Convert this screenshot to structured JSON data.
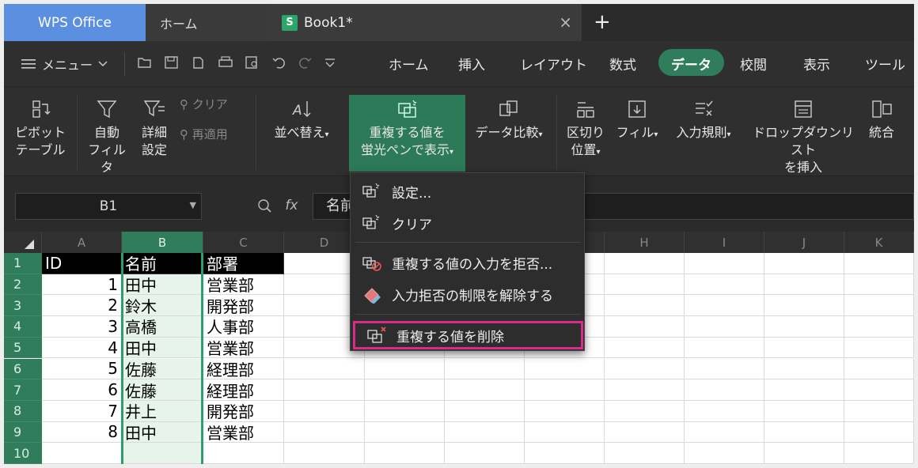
{
  "titlebar": {
    "app_tab": "WPS Office",
    "home_tab": "ホーム",
    "doc_tab": "Book1*",
    "doc_icon_letter": "S",
    "close_glyph": "×",
    "plus_glyph": "+"
  },
  "menubar": {
    "menu_label": "メニュー",
    "tabs": [
      "ホーム",
      "挿入",
      "レイアウト",
      "数式",
      "データ",
      "校閲",
      "表示",
      "ツール"
    ],
    "active_tab": "データ"
  },
  "ribbon": {
    "pivot": [
      "ピボット",
      "テーブル"
    ],
    "autofilter": [
      "自動",
      "フィルタ"
    ],
    "advanced": [
      "詳細",
      "設定"
    ],
    "clear": "クリア",
    "reapply": "再適用",
    "sort": "並べ替え",
    "highlight_dup": [
      "重複する値を",
      "蛍光ペンで表示"
    ],
    "compare": "データ比較",
    "split": [
      "区切り",
      "位置"
    ],
    "fill": "フィル",
    "validation": "入力規則",
    "dropdown_list": [
      "ドロップダウンリスト",
      "を挿入"
    ],
    "merge": "統合"
  },
  "formula_bar": {
    "name_box": "B1",
    "fx": "fx",
    "formula": "名前"
  },
  "grid": {
    "columns": [
      "A",
      "B",
      "C",
      "D",
      "E",
      "F",
      "G",
      "H",
      "I",
      "J",
      "K"
    ],
    "rows": [
      "1",
      "2",
      "3",
      "4",
      "5",
      "6",
      "7",
      "8",
      "9",
      "10"
    ],
    "header": [
      "ID",
      "名前",
      "部署"
    ],
    "data": [
      [
        "1",
        "田中",
        "営業部"
      ],
      [
        "2",
        "鈴木",
        "開発部"
      ],
      [
        "3",
        "高橋",
        "人事部"
      ],
      [
        "4",
        "田中",
        "営業部"
      ],
      [
        "5",
        "佐藤",
        "経理部"
      ],
      [
        "6",
        "佐藤",
        "経理部"
      ],
      [
        "7",
        "井上",
        "開発部"
      ],
      [
        "8",
        "田中",
        "営業部"
      ]
    ]
  },
  "dropdown": {
    "items": [
      "設定...",
      "クリア",
      "重複する値の入力を拒否...",
      "入力拒否の制限を解除する",
      "重複する値を削除"
    ],
    "highlight_color": "#d92b8a"
  },
  "colors": {
    "accent": "#2f7d5b",
    "wps_blue": "#5b8fdf"
  }
}
